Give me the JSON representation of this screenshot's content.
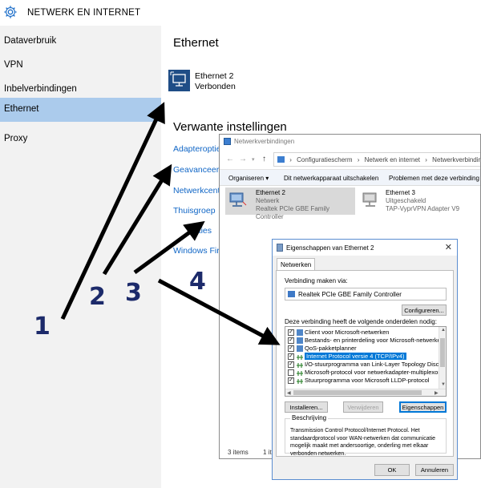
{
  "settings": {
    "header_title": "NETWERK EN INTERNET",
    "sidebar": [
      {
        "label": "Dataverbruik"
      },
      {
        "label": "VPN"
      },
      {
        "label": "Inbelverbindingen"
      },
      {
        "label": "Ethernet",
        "active": true
      },
      {
        "label": "Proxy"
      }
    ],
    "main_title": "Ethernet",
    "connection": {
      "name": "Ethernet 2",
      "status": "Verbonden"
    },
    "related_title": "Verwante instellingen",
    "related_links": [
      "Adapteropties",
      "Geavanceerde",
      "Netwerkcentr",
      "Thuisgroep",
      "opties",
      "Windows Fire"
    ]
  },
  "network_window": {
    "title": "Netwerkverbindingen",
    "breadcrumb": [
      "Configuratiescherm",
      "Netwerk en internet",
      "Netwerkverbinding"
    ],
    "commands": [
      "Organiseren ▾",
      "Dit netwerkapparaat uitschakelen",
      "Problemen met deze verbinding va"
    ],
    "adapters": [
      {
        "name": "Ethernet 2",
        "line2": "Netwerk",
        "line3": "Realtek PCIe GBE Family Controller",
        "selected": true
      },
      {
        "name": "Ethernet 3",
        "line2": "Uitgeschakeld",
        "line3": "TAP-VyprVPN Adapter V9",
        "selected": false
      }
    ],
    "status_count": "3 items",
    "status_sel": "1 iter"
  },
  "properties_dialog": {
    "title": "Eigenschappen van Ethernet 2",
    "tab": "Netwerken",
    "connect_via_label": "Verbinding maken via:",
    "connect_via_value": "Realtek PCIe GBE Family Controller",
    "configure_button": "Configureren...",
    "items_label": "Deze verbinding heeft de volgende onderdelen nodig:",
    "items": [
      {
        "label": "Client voor Microsoft-netwerken",
        "checked": true
      },
      {
        "label": "Bestands- en printerdeling voor Microsoft-netwerken",
        "checked": true
      },
      {
        "label": "QoS-pakketplanner",
        "checked": true
      },
      {
        "label": "Internet Protocol versie 4 (TCP/IPv4)",
        "checked": true,
        "highlighted": true
      },
      {
        "label": "I/O-stuurprogramma van Link-Layer Topology Discover",
        "checked": true
      },
      {
        "label": "Microsoft-protocol voor netwerkadapter-multiplexor",
        "checked": false
      },
      {
        "label": "Stuurprogramma voor Microsoft LLDP-protocol",
        "checked": true
      }
    ],
    "install_button": "Installeren...",
    "remove_button": "Verwijderen",
    "properties_button": "Eigenschappen",
    "description_legend": "Beschrijving",
    "description_text": "Transmission Control Protocol/Internet Protocol. Het standaardprotocol voor WAN-netwerken dat communicatie mogelijk maakt met andersoortige, onderling met elkaar verbonden netwerken.",
    "ok_button": "OK",
    "cancel_button": "Annuleren"
  },
  "annotations": {
    "labels": [
      "1",
      "2",
      "3",
      "4"
    ]
  }
}
